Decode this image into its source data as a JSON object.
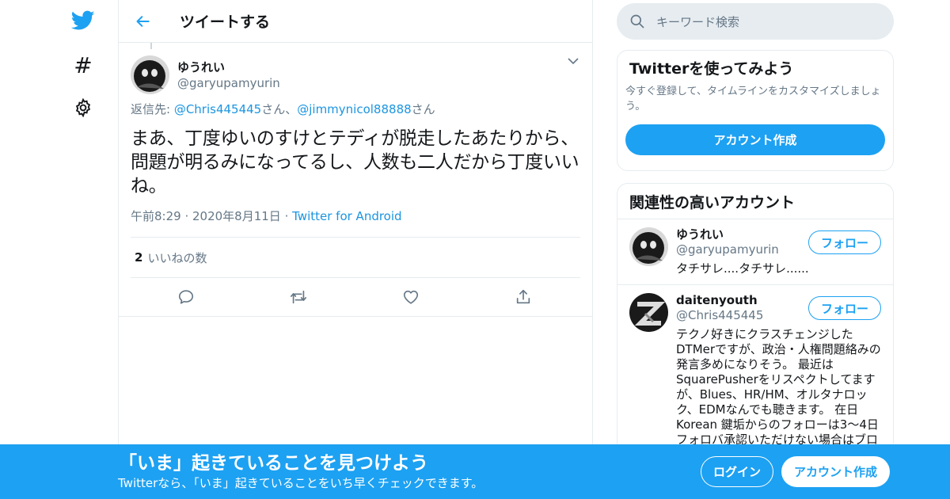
{
  "colors": {
    "accent": "#1da1f2",
    "link": "#1b95e0",
    "muted": "#657786",
    "border": "#e6ecf0"
  },
  "nav": {
    "icons": [
      "twitter-logo-icon",
      "hashtag-icon",
      "gear-icon"
    ],
    "explore_glyph": "#"
  },
  "header": {
    "title": "ツイートする"
  },
  "tweet": {
    "author_name": "ゆうれい",
    "author_handle": "@garyupamyurin",
    "reply_prefix": "返信先: ",
    "reply_user1": "@Chris445445",
    "reply_suffix1": "さん、",
    "reply_user2": "@jimmynicol88888",
    "reply_suffix2": "さん",
    "text": "まあ、丁度ゆいのすけとテディが脱走したあたりから、問題が明るみになってるし、人数も二人だから丁度いいね。",
    "time": "午前8:29",
    "dot1": " · ",
    "date": "2020年8月11日",
    "dot2": " · ",
    "source": "Twitter for Android",
    "likes_count": "2",
    "likes_label": "いいねの数"
  },
  "search": {
    "placeholder": "キーワード検索"
  },
  "signup_card": {
    "title": "Twitterを使ってみよう",
    "desc": "今すぐ登録して、タイムラインをカスタマイズしましょう。",
    "button": "アカウント作成"
  },
  "accounts": {
    "title": "関連性の高いアカウント",
    "items": [
      {
        "name": "ゆうれい",
        "handle": "@garyupamyurin",
        "bio": "タチサレ....タチサレ......",
        "follow": "フォロー"
      },
      {
        "name": "daitenyouth",
        "handle": "@Chris445445",
        "bio": "テクノ好きにクラスチェンジしたDTMerですが、政治・人権問題絡みの発言多めになりそう。 最近はSquarePusherをリスペクトしてますが、Blues、HR/HM、オルタナロック、EDMなんでも聴きます。 在日Korean 鍵垢からのフォローは3～4日フォロバ承認いただけない場合はブロ",
        "follow": "フォロー"
      }
    ]
  },
  "banner": {
    "title": "「いま」起きていることを見つけよう",
    "subtitle": "Twitterなら、「いま」起きていることをいち早くチェックできます。",
    "login": "ログイン",
    "signup": "アカウント作成"
  }
}
